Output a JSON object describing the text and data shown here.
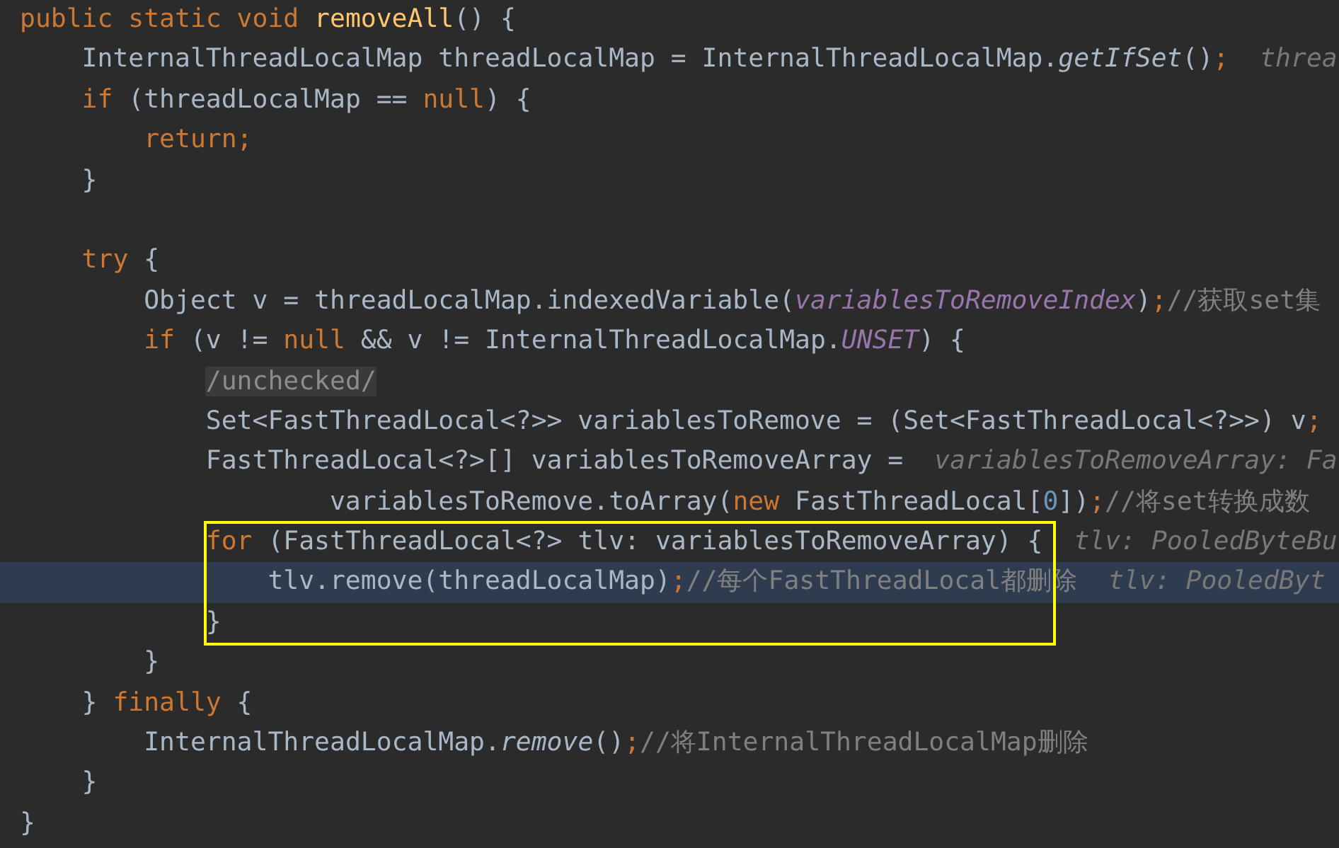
{
  "editor": {
    "lines": [
      {
        "tokens": [
          {
            "kind": "keyword",
            "text": "public static void "
          },
          {
            "kind": "declaration",
            "text": "removeAll"
          },
          {
            "kind": "plain",
            "text": "() {"
          }
        ],
        "current": false,
        "boxed": false,
        "children": [
          {
            "tokens": [
              {
                "kind": "plain",
                "text": "InternalThreadLocalMap threadLocalMap = InternalThreadLocalMap."
              },
              {
                "kind": "static-call",
                "text": "getIfSet"
              },
              {
                "kind": "plain",
                "text": "()"
              },
              {
                "kind": "keyword",
                "text": ";"
              }
            ],
            "hint": "threa",
            "current": false,
            "boxed": false
          },
          {
            "tokens": [
              {
                "kind": "keyword",
                "text": "if"
              },
              {
                "kind": "plain",
                "text": " (threadLocalMap == "
              },
              {
                "kind": "keyword",
                "text": "null"
              },
              {
                "kind": "plain",
                "text": ") {"
              }
            ],
            "current": false,
            "boxed": false,
            "children": [
              {
                "tokens": [
                  {
                    "kind": "keyword",
                    "text": "return;"
                  }
                ],
                "current": false,
                "boxed": false
              }
            ]
          },
          {
            "tokens": [
              {
                "kind": "plain",
                "text": "}"
              }
            ],
            "current": false,
            "boxed": false
          },
          {
            "current": false,
            "boxed": false
          },
          {
            "tokens": [
              {
                "kind": "keyword",
                "text": "try"
              },
              {
                "kind": "plain",
                "text": " {"
              }
            ],
            "current": false,
            "boxed": false,
            "children": [
              {
                "tokens": [
                  {
                    "kind": "plain",
                    "text": "Object v = threadLocalMap.indexedVariable("
                  },
                  {
                    "kind": "field",
                    "text": "variablesToRemoveIndex"
                  },
                  {
                    "kind": "plain",
                    "text": ")"
                  },
                  {
                    "kind": "keyword",
                    "text": ";"
                  },
                  {
                    "kind": "comment",
                    "text": "//获取set集"
                  }
                ],
                "current": false,
                "boxed": false
              },
              {
                "tokens": [
                  {
                    "kind": "keyword",
                    "text": "if"
                  },
                  {
                    "kind": "plain",
                    "text": " (v != "
                  },
                  {
                    "kind": "keyword",
                    "text": "null"
                  },
                  {
                    "kind": "plain",
                    "text": " && v != InternalThreadLocalMap."
                  },
                  {
                    "kind": "field",
                    "text": "UNSET"
                  },
                  {
                    "kind": "plain",
                    "text": ") {"
                  }
                ],
                "current": false,
                "boxed": false,
                "children": [
                  {
                    "tokens": [
                      {
                        "kind": "folded",
                        "text": "/unchecked/"
                      }
                    ],
                    "current": false,
                    "boxed": false
                  },
                  {
                    "tokens": [
                      {
                        "kind": "plain",
                        "text": "Set<FastThreadLocal<?>> variablesToRemove = (Set<FastThreadLocal<?>>) v"
                      },
                      {
                        "kind": "keyword",
                        "text": ";"
                      }
                    ],
                    "current": false,
                    "boxed": false
                  },
                  {
                    "tokens": [
                      {
                        "kind": "plain",
                        "text": "FastThreadLocal<?>[] variablesToRemoveArray ="
                      }
                    ],
                    "hint": "variablesToRemoveArray: Fa",
                    "current": false,
                    "boxed": false,
                    "children": [
                      {
                        "continuation": true,
                        "tokens": [
                          {
                            "kind": "plain",
                            "text": "variablesToRemove.toArray("
                          },
                          {
                            "kind": "keyword",
                            "text": "new"
                          },
                          {
                            "kind": "plain",
                            "text": " FastThreadLocal["
                          },
                          {
                            "kind": "number",
                            "text": "0"
                          },
                          {
                            "kind": "plain",
                            "text": "])"
                          },
                          {
                            "kind": "keyword",
                            "text": ";"
                          },
                          {
                            "kind": "comment",
                            "text": "//将set转换成数"
                          }
                        ],
                        "current": false,
                        "boxed": false
                      }
                    ]
                  },
                  {
                    "tokens": [
                      {
                        "kind": "keyword",
                        "text": "for"
                      },
                      {
                        "kind": "plain",
                        "text": " (FastThreadLocal<?> tlv: variablesToRemoveArray) {"
                      }
                    ],
                    "hint": "tlv: PooledByteBu",
                    "current": false,
                    "boxed": true,
                    "children": [
                      {
                        "tokens": [
                          {
                            "kind": "plain",
                            "text": "tlv.remove(threadLocalMap)"
                          },
                          {
                            "kind": "keyword",
                            "text": ";"
                          },
                          {
                            "kind": "comment",
                            "text": "//每个FastThreadLocal都删除"
                          }
                        ],
                        "hint": "tlv: PooledByt",
                        "current": true,
                        "boxed": true
                      }
                    ]
                  },
                  {
                    "tokens": [
                      {
                        "kind": "plain",
                        "text": "}"
                      }
                    ],
                    "current": false,
                    "boxed": true
                  }
                ]
              },
              {
                "tokens": [
                  {
                    "kind": "plain",
                    "text": "}"
                  }
                ],
                "current": false,
                "boxed": false
              }
            ]
          },
          {
            "tokens": [
              {
                "kind": "plain",
                "text": "} "
              },
              {
                "kind": "keyword",
                "text": "finally"
              },
              {
                "kind": "plain",
                "text": " {"
              }
            ],
            "current": false,
            "boxed": false,
            "children": [
              {
                "tokens": [
                  {
                    "kind": "plain",
                    "text": "InternalThreadLocalMap."
                  },
                  {
                    "kind": "static-call",
                    "text": "remove"
                  },
                  {
                    "kind": "plain",
                    "text": "()"
                  },
                  {
                    "kind": "keyword",
                    "text": ";"
                  },
                  {
                    "kind": "comment",
                    "text": "//将InternalThreadLocalMap删除"
                  }
                ],
                "current": false,
                "boxed": false
              }
            ]
          },
          {
            "tokens": [
              {
                "kind": "plain",
                "text": "}"
              }
            ],
            "current": false,
            "boxed": false
          }
        ]
      },
      {
        "tokens": [
          {
            "kind": "plain",
            "text": "}"
          }
        ],
        "current": false,
        "boxed": false
      }
    ]
  }
}
